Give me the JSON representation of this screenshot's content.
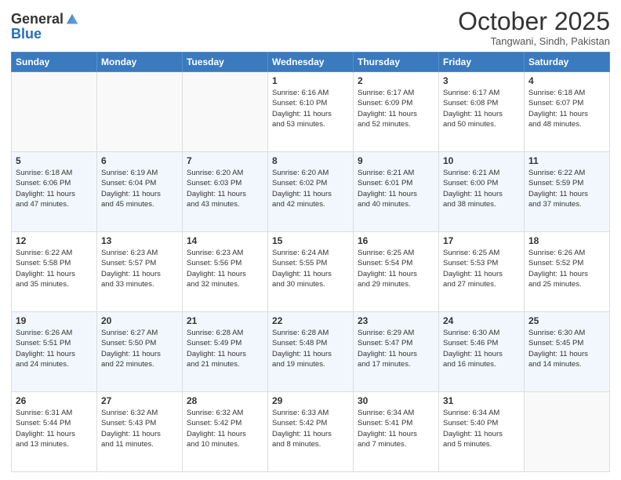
{
  "logo": {
    "general": "General",
    "blue": "Blue"
  },
  "header": {
    "month": "October 2025",
    "location": "Tangwani, Sindh, Pakistan"
  },
  "weekdays": [
    "Sunday",
    "Monday",
    "Tuesday",
    "Wednesday",
    "Thursday",
    "Friday",
    "Saturday"
  ],
  "weeks": [
    [
      {
        "day": "",
        "info": ""
      },
      {
        "day": "",
        "info": ""
      },
      {
        "day": "",
        "info": ""
      },
      {
        "day": "1",
        "info": "Sunrise: 6:16 AM\nSunset: 6:10 PM\nDaylight: 11 hours\nand 53 minutes."
      },
      {
        "day": "2",
        "info": "Sunrise: 6:17 AM\nSunset: 6:09 PM\nDaylight: 11 hours\nand 52 minutes."
      },
      {
        "day": "3",
        "info": "Sunrise: 6:17 AM\nSunset: 6:08 PM\nDaylight: 11 hours\nand 50 minutes."
      },
      {
        "day": "4",
        "info": "Sunrise: 6:18 AM\nSunset: 6:07 PM\nDaylight: 11 hours\nand 48 minutes."
      }
    ],
    [
      {
        "day": "5",
        "info": "Sunrise: 6:18 AM\nSunset: 6:06 PM\nDaylight: 11 hours\nand 47 minutes."
      },
      {
        "day": "6",
        "info": "Sunrise: 6:19 AM\nSunset: 6:04 PM\nDaylight: 11 hours\nand 45 minutes."
      },
      {
        "day": "7",
        "info": "Sunrise: 6:20 AM\nSunset: 6:03 PM\nDaylight: 11 hours\nand 43 minutes."
      },
      {
        "day": "8",
        "info": "Sunrise: 6:20 AM\nSunset: 6:02 PM\nDaylight: 11 hours\nand 42 minutes."
      },
      {
        "day": "9",
        "info": "Sunrise: 6:21 AM\nSunset: 6:01 PM\nDaylight: 11 hours\nand 40 minutes."
      },
      {
        "day": "10",
        "info": "Sunrise: 6:21 AM\nSunset: 6:00 PM\nDaylight: 11 hours\nand 38 minutes."
      },
      {
        "day": "11",
        "info": "Sunrise: 6:22 AM\nSunset: 5:59 PM\nDaylight: 11 hours\nand 37 minutes."
      }
    ],
    [
      {
        "day": "12",
        "info": "Sunrise: 6:22 AM\nSunset: 5:58 PM\nDaylight: 11 hours\nand 35 minutes."
      },
      {
        "day": "13",
        "info": "Sunrise: 6:23 AM\nSunset: 5:57 PM\nDaylight: 11 hours\nand 33 minutes."
      },
      {
        "day": "14",
        "info": "Sunrise: 6:23 AM\nSunset: 5:56 PM\nDaylight: 11 hours\nand 32 minutes."
      },
      {
        "day": "15",
        "info": "Sunrise: 6:24 AM\nSunset: 5:55 PM\nDaylight: 11 hours\nand 30 minutes."
      },
      {
        "day": "16",
        "info": "Sunrise: 6:25 AM\nSunset: 5:54 PM\nDaylight: 11 hours\nand 29 minutes."
      },
      {
        "day": "17",
        "info": "Sunrise: 6:25 AM\nSunset: 5:53 PM\nDaylight: 11 hours\nand 27 minutes."
      },
      {
        "day": "18",
        "info": "Sunrise: 6:26 AM\nSunset: 5:52 PM\nDaylight: 11 hours\nand 25 minutes."
      }
    ],
    [
      {
        "day": "19",
        "info": "Sunrise: 6:26 AM\nSunset: 5:51 PM\nDaylight: 11 hours\nand 24 minutes."
      },
      {
        "day": "20",
        "info": "Sunrise: 6:27 AM\nSunset: 5:50 PM\nDaylight: 11 hours\nand 22 minutes."
      },
      {
        "day": "21",
        "info": "Sunrise: 6:28 AM\nSunset: 5:49 PM\nDaylight: 11 hours\nand 21 minutes."
      },
      {
        "day": "22",
        "info": "Sunrise: 6:28 AM\nSunset: 5:48 PM\nDaylight: 11 hours\nand 19 minutes."
      },
      {
        "day": "23",
        "info": "Sunrise: 6:29 AM\nSunset: 5:47 PM\nDaylight: 11 hours\nand 17 minutes."
      },
      {
        "day": "24",
        "info": "Sunrise: 6:30 AM\nSunset: 5:46 PM\nDaylight: 11 hours\nand 16 minutes."
      },
      {
        "day": "25",
        "info": "Sunrise: 6:30 AM\nSunset: 5:45 PM\nDaylight: 11 hours\nand 14 minutes."
      }
    ],
    [
      {
        "day": "26",
        "info": "Sunrise: 6:31 AM\nSunset: 5:44 PM\nDaylight: 11 hours\nand 13 minutes."
      },
      {
        "day": "27",
        "info": "Sunrise: 6:32 AM\nSunset: 5:43 PM\nDaylight: 11 hours\nand 11 minutes."
      },
      {
        "day": "28",
        "info": "Sunrise: 6:32 AM\nSunset: 5:42 PM\nDaylight: 11 hours\nand 10 minutes."
      },
      {
        "day": "29",
        "info": "Sunrise: 6:33 AM\nSunset: 5:42 PM\nDaylight: 11 hours\nand 8 minutes."
      },
      {
        "day": "30",
        "info": "Sunrise: 6:34 AM\nSunset: 5:41 PM\nDaylight: 11 hours\nand 7 minutes."
      },
      {
        "day": "31",
        "info": "Sunrise: 6:34 AM\nSunset: 5:40 PM\nDaylight: 11 hours\nand 5 minutes."
      },
      {
        "day": "",
        "info": ""
      }
    ]
  ]
}
